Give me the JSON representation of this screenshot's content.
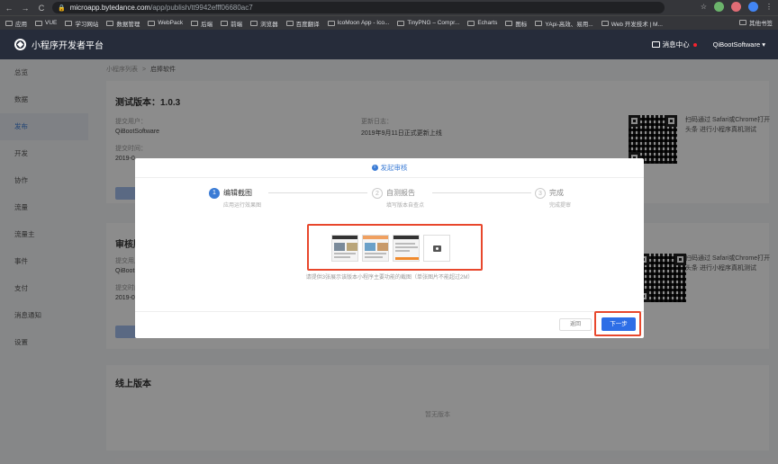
{
  "browser": {
    "url_host": "microapp.bytedance.com",
    "url_path": "/app/publish/tt9942efff06680ac7",
    "bookmarks": [
      "应用",
      "VUE",
      "学习网站",
      "数据管理",
      "WebPack",
      "后端",
      "前端",
      "浏览器",
      "百度翻译",
      "IcoMoon App - Ico...",
      "TinyPNG – Compr...",
      "Echarts",
      "图标",
      "YApi-高效、易用...",
      "Web 开发技术 | M..."
    ],
    "other_bookmarks": "其他书签",
    "ext_colors": [
      "#6bb36b",
      "#e06c75",
      "#4285f4"
    ]
  },
  "header": {
    "title": "小程序开发者平台",
    "messages": "消息中心",
    "account": "QiBootSoftware"
  },
  "sidebar": {
    "items": [
      "总览",
      "数据",
      "发布",
      "开发",
      "协作",
      "流量",
      "流量主",
      "事件",
      "支付",
      "消息通知",
      "设置"
    ],
    "active_index": 2
  },
  "breadcrumb": {
    "parent": "小程序列表",
    "sep": ">",
    "current": "启捧软件"
  },
  "test_card": {
    "title": "测试版本：1.0.3",
    "submitter_label": "提交用户：",
    "submitter": "QiBootSoftware",
    "time_label": "提交时间：",
    "time": "2019-0",
    "log_label": "更新日志：",
    "log": "2019年9月11日正式更新上线",
    "qr_text": "扫码通过 Safari或Chrome打开头条 进行小程序真机测试"
  },
  "review_card": {
    "title": "审核版",
    "submitter_label": "提交用户",
    "submitter": "QiBoot",
    "time_label": "提交时间",
    "time": "2019-0",
    "qr_text": "扫码通过 Safari或Chrome打开头条 进行小程序真机测试"
  },
  "online_card": {
    "title": "线上版本",
    "empty": "暂无版本"
  },
  "modal": {
    "title": "发起审核",
    "steps": [
      {
        "num": "1",
        "title": "编辑截图",
        "desc": "应用运行效果图"
      },
      {
        "num": "2",
        "title": "自测报告",
        "desc": "填写版本自查点"
      },
      {
        "num": "3",
        "title": "完成",
        "desc": "完成提审"
      }
    ],
    "hint": "请提供3张展示该版本小程序主要功能的截图（单张图片不能超过2M）",
    "back": "返回",
    "next": "下一步"
  }
}
